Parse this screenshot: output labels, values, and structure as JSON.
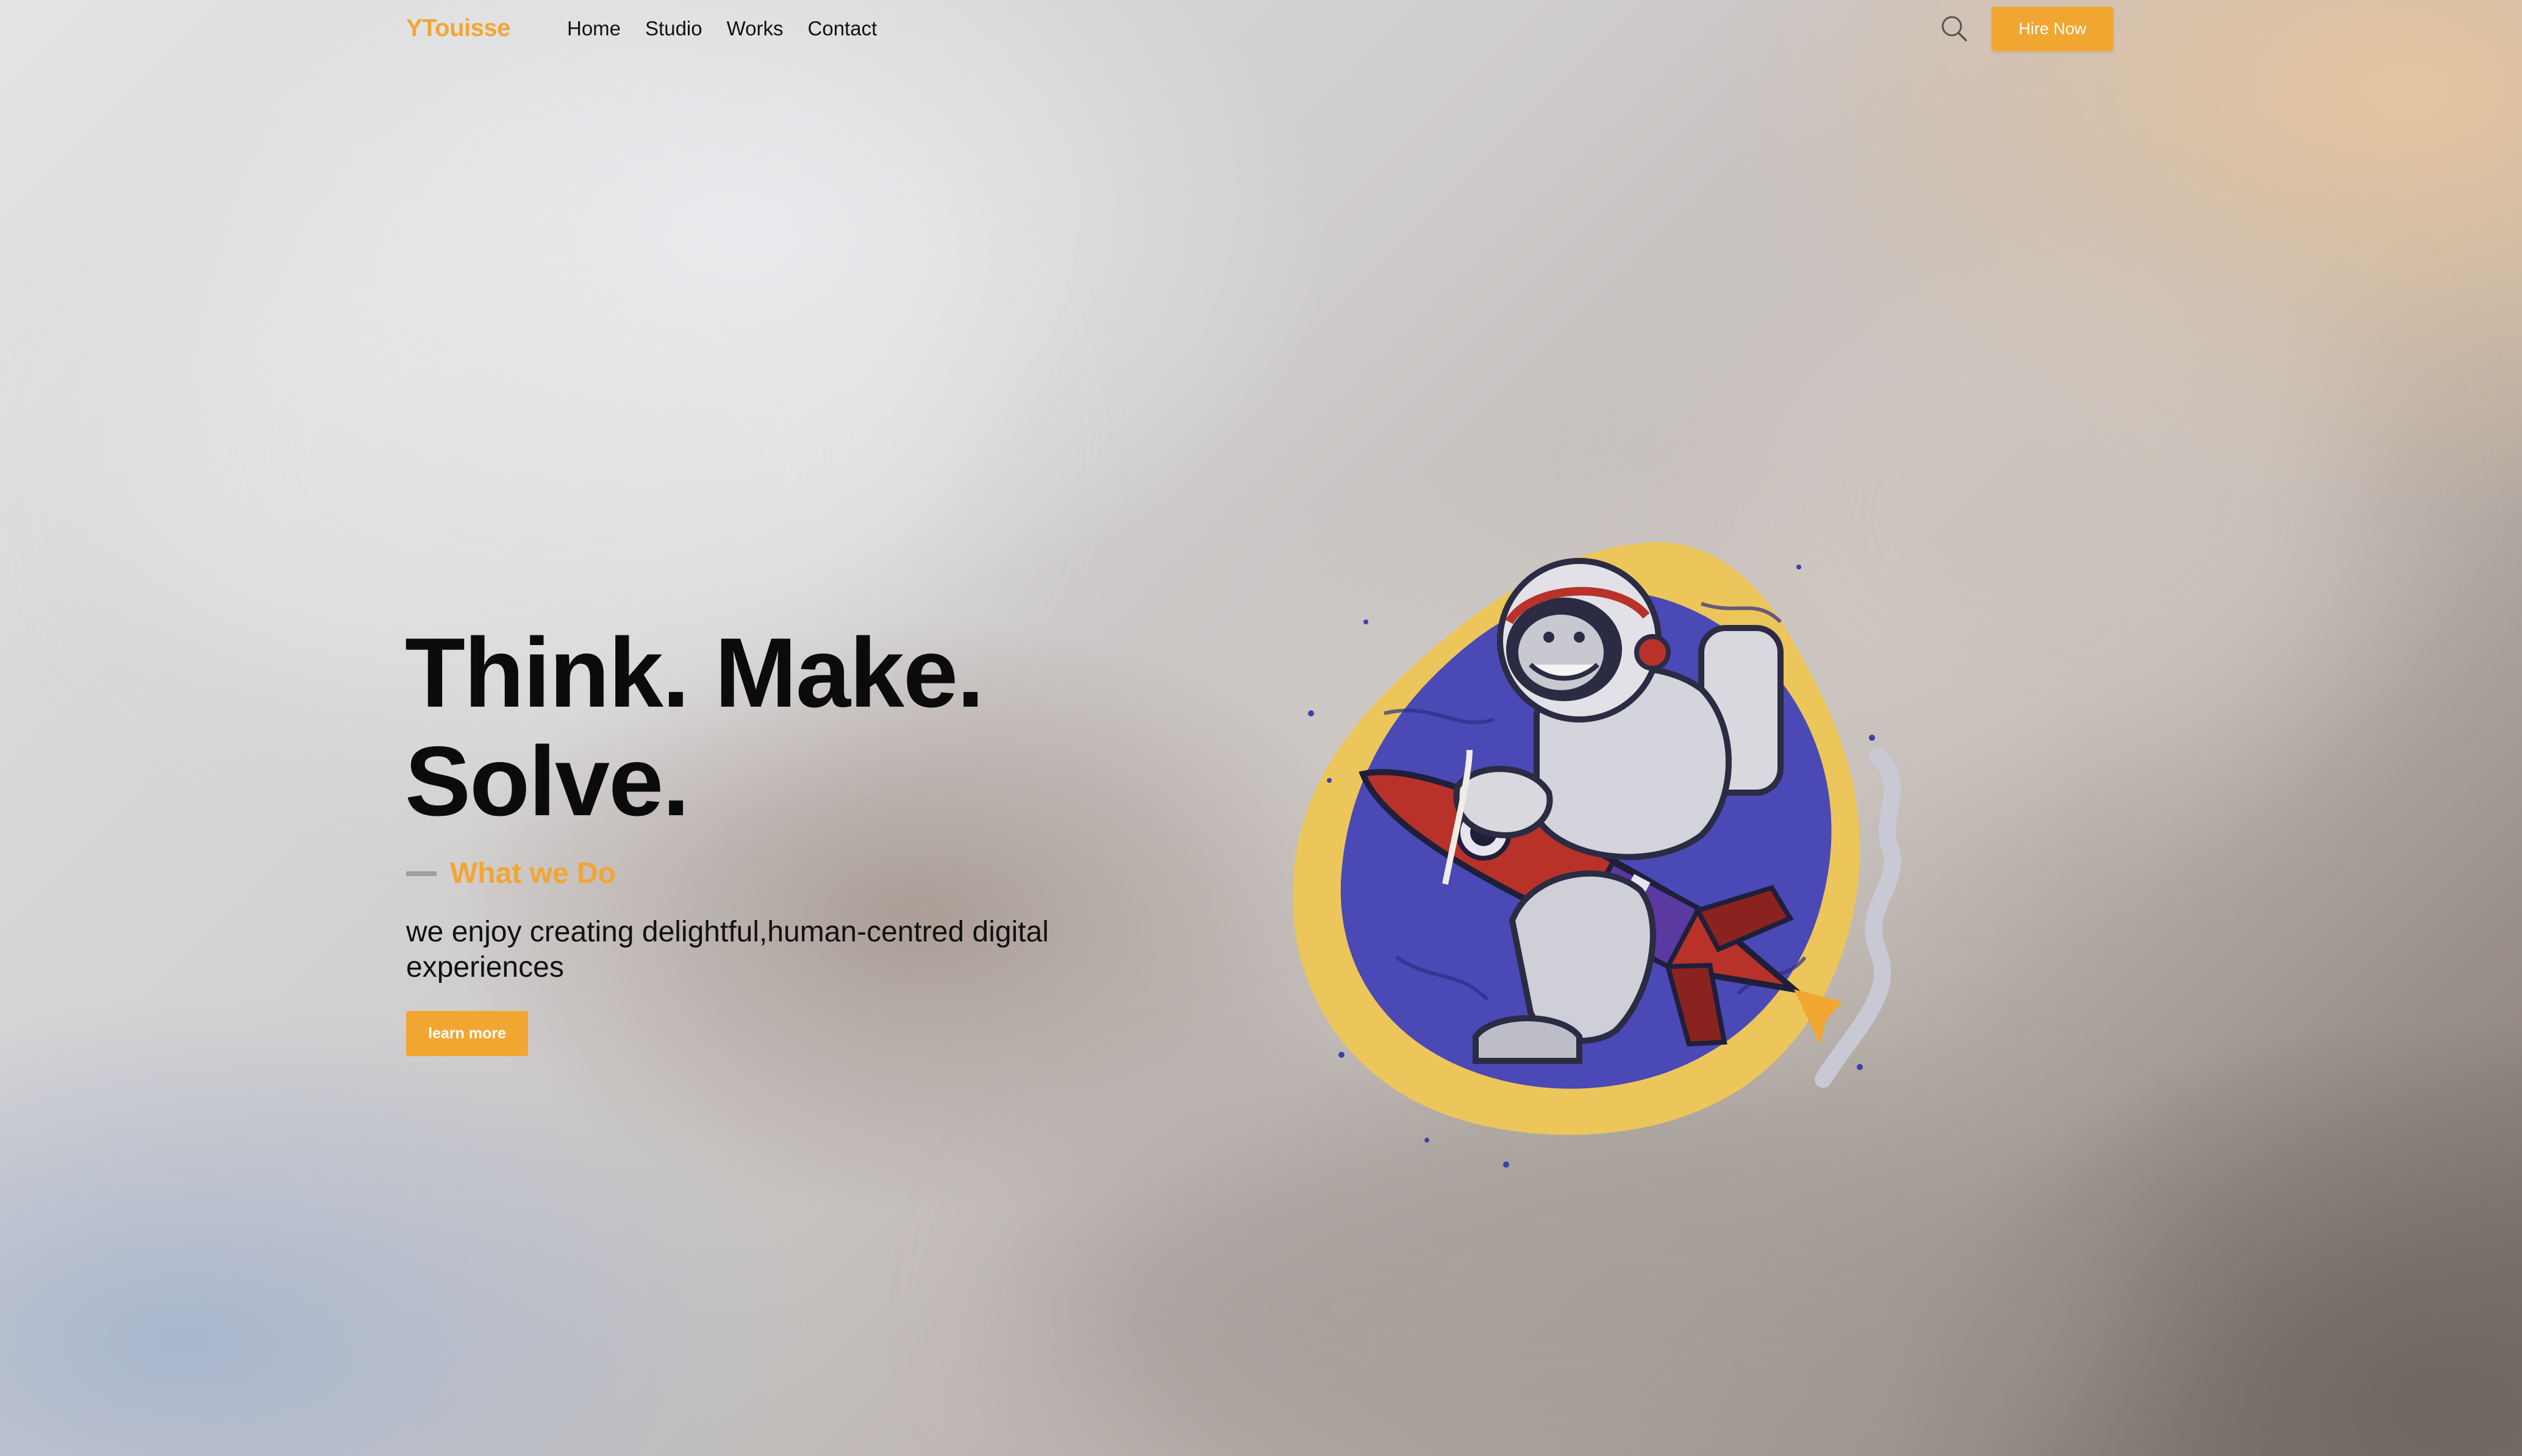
{
  "brand": {
    "name": "YTouisse"
  },
  "nav": {
    "items": [
      {
        "label": "Home"
      },
      {
        "label": "Studio"
      },
      {
        "label": "Works"
      },
      {
        "label": "Contact"
      }
    ]
  },
  "header": {
    "search_icon": "search-icon",
    "cta_label": "Hire Now"
  },
  "hero": {
    "title_line1": "Think. Make.",
    "title_line2": "Solve.",
    "section_label": "What we Do",
    "description": "we enjoy creating delightful,human-centred digital experiences",
    "button_label": "learn more",
    "illustration": "astronaut-riding-rocket-illustration"
  },
  "colors": {
    "accent": "#f2a632",
    "text": "#0b0b0b",
    "blob_yellow": "#ecc65a",
    "blob_blue": "#4a49b5"
  }
}
